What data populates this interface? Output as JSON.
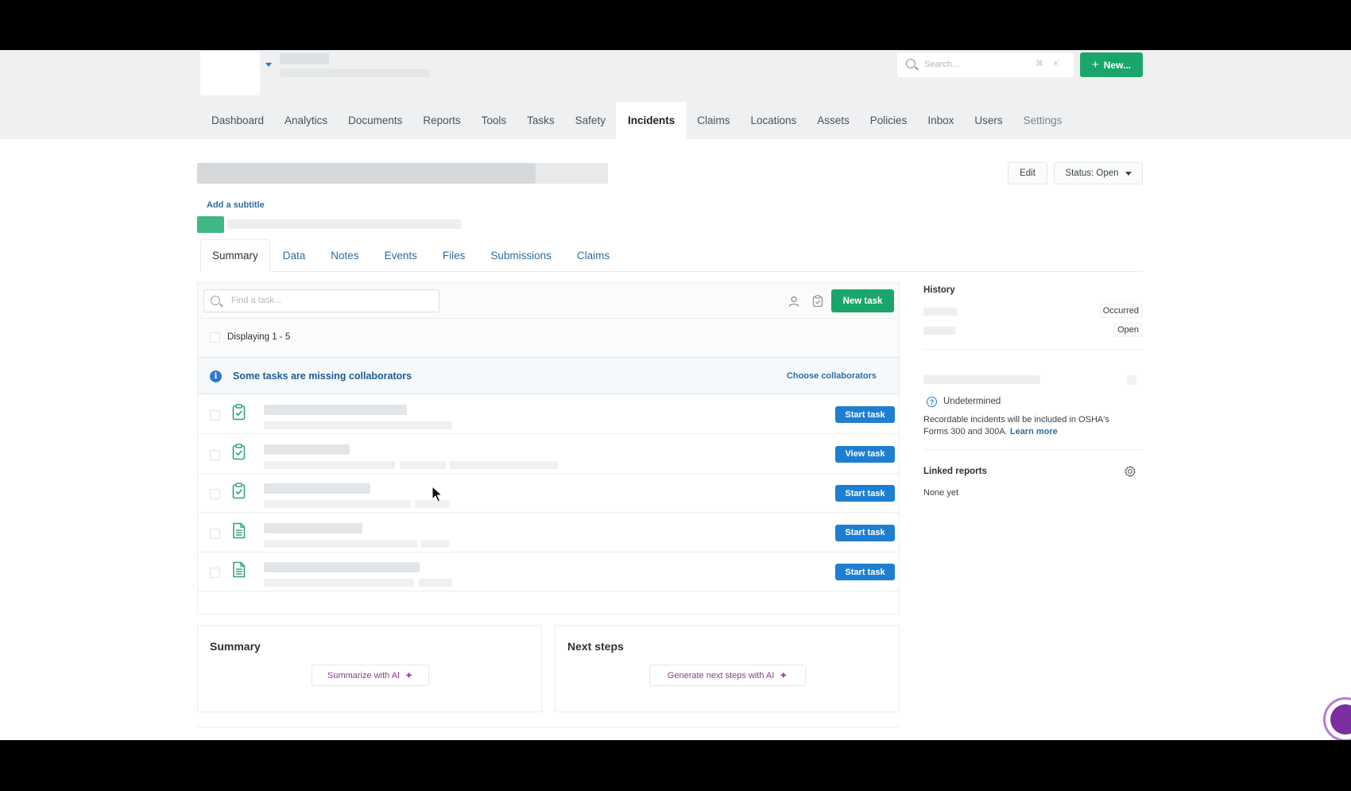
{
  "header": {
    "search": {
      "placeholder": "Search...",
      "shortcut_mod": "⌘",
      "shortcut_key": "K"
    },
    "new_button": "New..."
  },
  "nav": {
    "items": [
      {
        "label": "Dashboard",
        "active": false
      },
      {
        "label": "Analytics",
        "active": false
      },
      {
        "label": "Documents",
        "active": false
      },
      {
        "label": "Reports",
        "active": false
      },
      {
        "label": "Tools",
        "active": false
      },
      {
        "label": "Tasks",
        "active": false
      },
      {
        "label": "Safety",
        "active": false
      },
      {
        "label": "Incidents",
        "active": true
      },
      {
        "label": "Claims",
        "active": false
      },
      {
        "label": "Locations",
        "active": false
      },
      {
        "label": "Assets",
        "active": false
      },
      {
        "label": "Policies",
        "active": false
      },
      {
        "label": "Inbox",
        "active": false
      },
      {
        "label": "Users",
        "active": false
      },
      {
        "label": "Settings",
        "active": false
      }
    ]
  },
  "record": {
    "subtitle_link": "Add a subtitle",
    "edit_button": "Edit",
    "status_button": "Status: Open"
  },
  "tabs": [
    "Summary",
    "Data",
    "Notes",
    "Events",
    "Files",
    "Submissions",
    "Claims"
  ],
  "tasks": {
    "search_placeholder": "Find a task...",
    "new_task_button": "New task",
    "displaying": "Displaying 1 - 5",
    "alert": {
      "message": "Some tasks are missing collaborators",
      "action": "Choose collaborators"
    },
    "rows": [
      {
        "icon": "clipboard-check-icon",
        "action": "Start task"
      },
      {
        "icon": "clipboard-check-icon",
        "action": "View task"
      },
      {
        "icon": "clipboard-check-icon",
        "action": "Start task"
      },
      {
        "icon": "document-icon",
        "action": "Start task"
      },
      {
        "icon": "document-icon",
        "action": "Start task"
      }
    ]
  },
  "summary_card": {
    "title": "Summary",
    "button": "Summarize with AI"
  },
  "next_steps_card": {
    "title": "Next steps",
    "button": "Generate next steps with AI"
  },
  "sidebar": {
    "history_title": "History",
    "history": [
      {
        "badge": "Occurred"
      },
      {
        "badge": "Open"
      }
    ],
    "recordable_status": "Undetermined",
    "recordable_note": "Recordable incidents will be included in OSHA's Forms 300 and 300A.",
    "learn_more": "Learn more",
    "linked_title": "Linked reports",
    "linked_value": "None yet"
  },
  "colors": {
    "primary_green": "#1aa66a",
    "primary_blue": "#1e7fd1",
    "link": "#2b6ea3",
    "ai_purple": "#8a3d8f"
  }
}
